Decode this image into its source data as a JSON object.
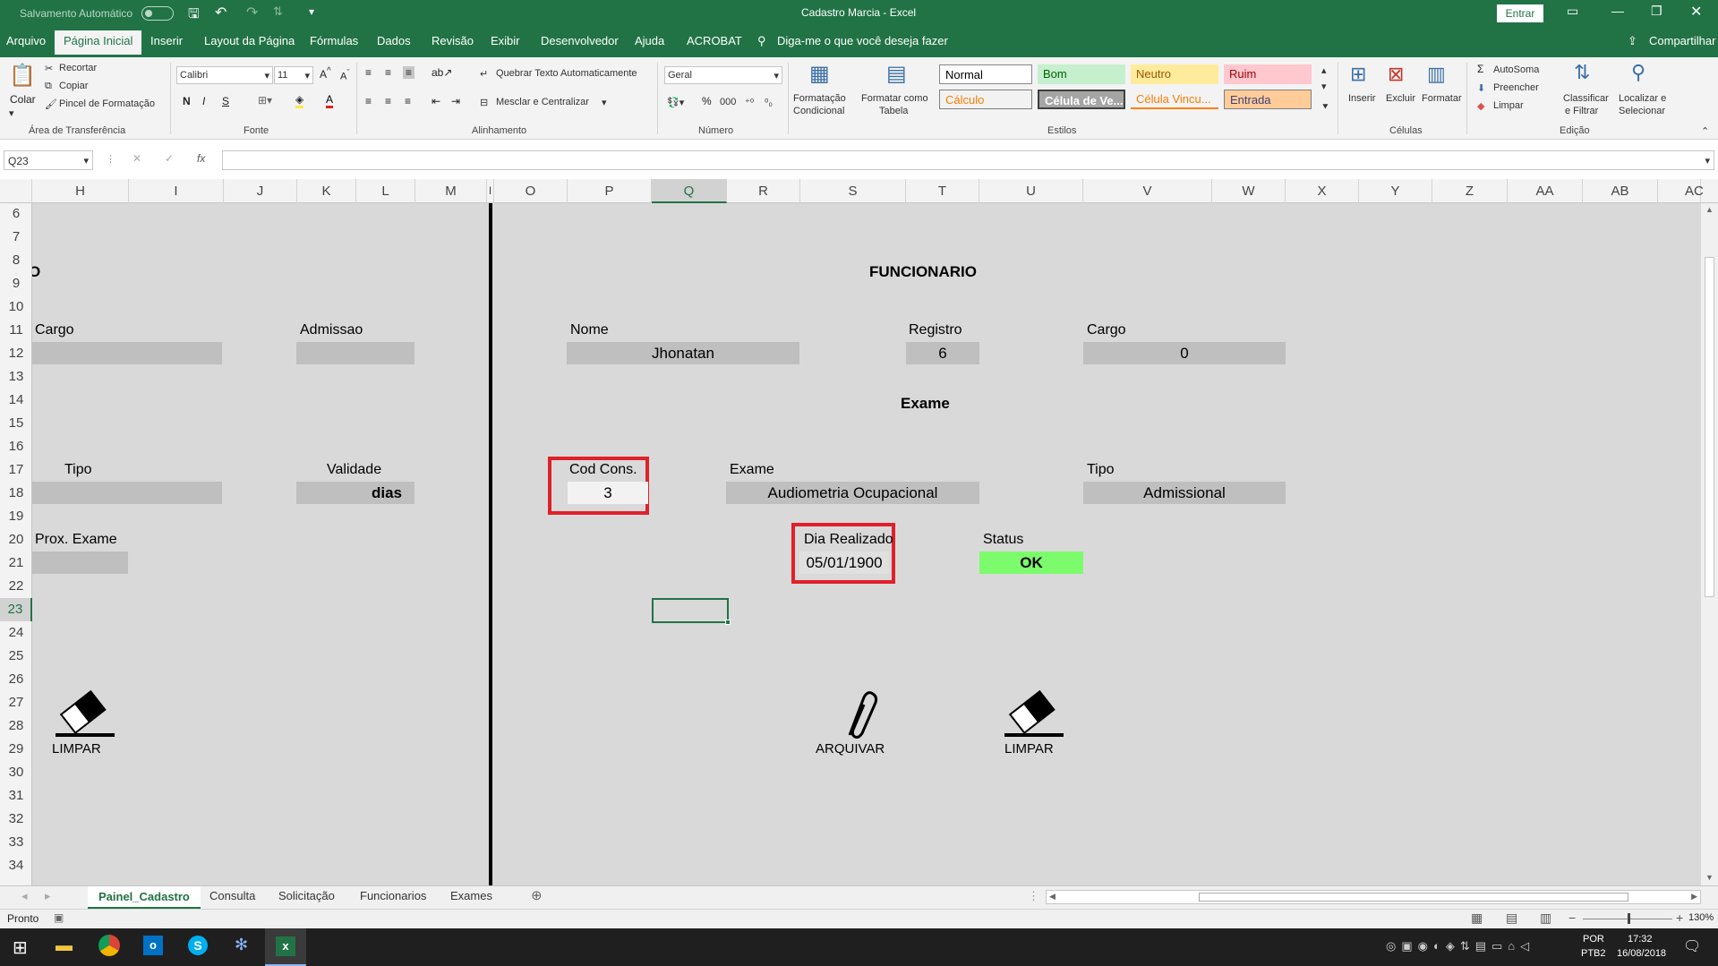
{
  "titlebar": {
    "autosave": "Salvamento Automático",
    "title": "Cadastro Marcia  -  Excel",
    "signin": "Entrar"
  },
  "menu": [
    "Arquivo",
    "Página Inicial",
    "Inserir",
    "Layout da Página",
    "Fórmulas",
    "Dados",
    "Revisão",
    "Exibir",
    "Desenvolvedor",
    "Ajuda",
    "ACROBAT"
  ],
  "tellme": "Diga-me o que você deseja fazer",
  "share": "Compartilhar",
  "ribbon": {
    "paste": "Colar",
    "cut": "Recortar",
    "copy": "Copiar",
    "format_painter": "Pincel de Formatação",
    "grp_clipboard": "Área de Transferência",
    "font_name": "Calibri",
    "font_size": "11",
    "bold": "N",
    "italic": "I",
    "underline": "S",
    "grp_font": "Fonte",
    "wrap_text": "Quebrar Texto Automaticamente",
    "merge_center": "Mesclar e Centralizar",
    "grp_alignment": "Alinhamento",
    "number_format": "Geral",
    "grp_number": "Número",
    "cond_format_1": "Formatação",
    "cond_format_2": "Condicional",
    "format_table_1": "Formatar como",
    "format_table_2": "Tabela",
    "styles": {
      "normal": "Normal",
      "bom": "Bom",
      "neutro": "Neutro",
      "ruim": "Ruim",
      "calculo": "Cálculo",
      "celula_verif": "Célula de Ve...",
      "celula_vinc": "Célula Vincu...",
      "entrada": "Entrada"
    },
    "grp_styles": "Estilos",
    "insert": "Inserir",
    "delete": "Excluir",
    "format": "Formatar",
    "grp_cells": "Células",
    "autosum": "AutoSoma",
    "fill": "Preencher",
    "clear": "Limpar",
    "sort_1": "Classificar",
    "sort_2": "e Filtrar",
    "find_1": "Localizar e",
    "find_2": "Selecionar",
    "grp_edit": "Edição"
  },
  "formula_bar": {
    "name_box": "Q23",
    "fx": "fx"
  },
  "columns": [
    "H",
    "I",
    "J",
    "K",
    "L",
    "M",
    "I",
    "O",
    "P",
    "Q",
    "R",
    "S",
    "T",
    "U",
    "V",
    "W",
    "X",
    "Y",
    "Z",
    "AA",
    "AB",
    "AC"
  ],
  "rows": [
    "6",
    "7",
    "8",
    "9",
    "10",
    "11",
    "12",
    "13",
    "14",
    "15",
    "16",
    "17",
    "18",
    "19",
    "20",
    "21",
    "22",
    "23",
    "24",
    "25",
    "26",
    "27",
    "28",
    "29",
    "30",
    "31",
    "32",
    "33",
    "34"
  ],
  "left_panel": {
    "partial_letter": "O",
    "cargo_label": "Cargo",
    "admissao_label": "Admissao",
    "tipo_label": "Tipo",
    "validade_label": "Validade",
    "validade_value": "dias",
    "prox_exame_label": "Prox. Exame",
    "limpar_label": "LIMPAR"
  },
  "right_panel": {
    "funcionario_title": "FUNCIONARIO",
    "nome_label": "Nome",
    "nome_value": "Jhonatan",
    "registro_label": "Registro",
    "registro_value": "6",
    "cargo_label": "Cargo",
    "cargo_value": "0",
    "exame_title": "Exame",
    "cod_cons_label": "Cod Cons.",
    "cod_cons_value": "3",
    "exame_label": "Exame",
    "exame_value": "Audiometria Ocupacional",
    "tipo_label": "Tipo",
    "tipo_value": "Admissional",
    "dia_realizado_label": "Dia Realizado",
    "dia_realizado_value": "05/01/1900",
    "status_label": "Status",
    "status_value": "OK",
    "arquivar_label": "ARQUIVAR",
    "limpar_label": "LIMPAR"
  },
  "sheet_tabs": [
    "Painel_Cadastro",
    "Consulta",
    "Solicitação",
    "Funcionarios",
    "Exames"
  ],
  "status_bar": {
    "ready": "Pronto",
    "zoom": "130%"
  },
  "taskbar": {
    "lang1": "POR",
    "lang2": "PTB2",
    "time": "17:32",
    "date": "16/08/2018"
  },
  "colors": {
    "excel_green": "#217346",
    "sheet_bg": "#d9d9d9",
    "field_bg": "#bfbfbf",
    "highlight_red": "#e0202a",
    "status_ok": "#7cfc6c"
  }
}
